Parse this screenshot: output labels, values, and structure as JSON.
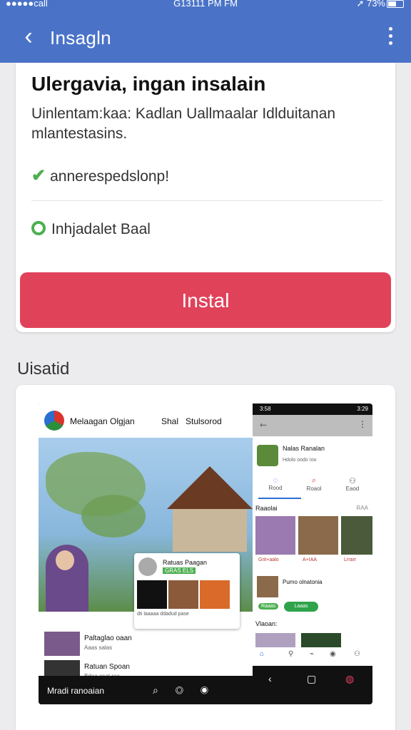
{
  "status_bar": {
    "left": "●●●●●call",
    "center": "G13111 PM FM",
    "right": "73%"
  },
  "app_bar": {
    "title": "Insagln"
  },
  "install_card": {
    "title": "Ulergavia, ingan insalain",
    "description": "Uinlentam:kaa: Kadlan Uallmaalar Idlduitanan mlantestasins.",
    "check_label": "annerespedslonp!",
    "radio_label": "Inhjadalet Baal",
    "install_button": "Instal"
  },
  "section": {
    "label": "Uisatid"
  },
  "preview": {
    "web": {
      "brand": "Melaagan Olgjan",
      "nav": [
        "Shal",
        "Stulsorod"
      ],
      "overlay_title": "Ratuas Paagan",
      "overlay_tag": "GRAS ELS",
      "overlay_caps": "dti    laaaaa    ddadud    pase",
      "list": [
        {
          "title": "Paltaglao oaan",
          "sub": "Aaas salas"
        },
        {
          "title": "Ratuan Spoan",
          "sub": "Bdaa asat raa"
        }
      ],
      "footer_label": "Mradi ranoaian"
    },
    "phone": {
      "time": "3:58",
      "battery": "3:29",
      "app_name": "Nalas Ranalan",
      "app_meta": "Hdolo  oodo  Ioo",
      "tabs": [
        "Rood",
        "Roaol",
        "Eaod"
      ],
      "section1": "Raaolai",
      "section1_more": "RAA",
      "captions": [
        "Grit+aalo",
        "A+IAA",
        "Lrrarr"
      ],
      "row2_title": "Pumo olnatonia",
      "row2_tag": "Raaas",
      "row2_button": "Laaas",
      "section2": "Vlaoan:"
    }
  }
}
